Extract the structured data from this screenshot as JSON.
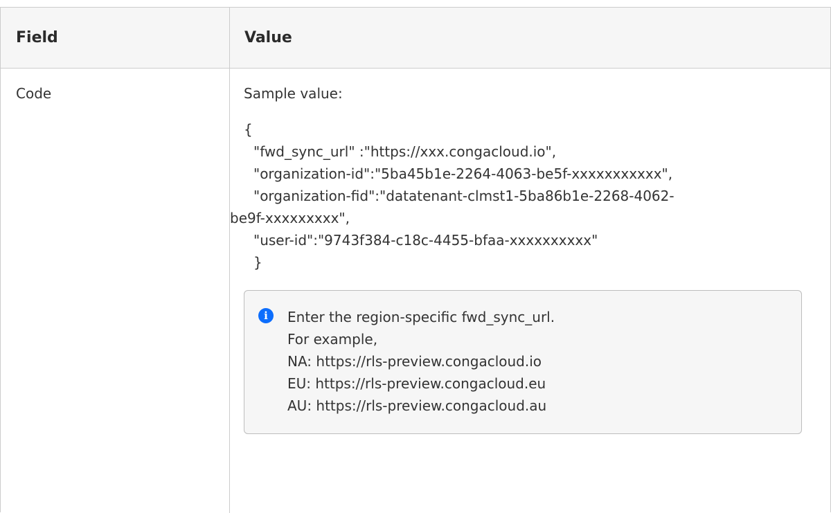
{
  "table": {
    "headers": {
      "field": "Field",
      "value": "Value"
    },
    "rows": [
      {
        "field": "Code",
        "sample_label": "Sample value:",
        "code": {
          "open": "{",
          "line1": "\"fwd_sync_url\" :\"https://xxx.congacloud.io\",",
          "line2": "\"organization-id\":\"5ba45b1e-2264-4063-be5f-xxxxxxxxxxx\",",
          "line3a": "\"organization-fid\":\"datatenant-clmst1-5ba86b1e-2268-4062-",
          "line3b": "be9f-xxxxxxxxx\",",
          "line4": "\"user-id\":\"9743f384-c18c-4455-bfaa-xxxxxxxxxx\"",
          "close": "}"
        },
        "note": {
          "icon": "info-icon",
          "icon_color": "#0d6efd",
          "lines": [
            "Enter the region-specific fwd_sync_url.",
            "For example,",
            "NA: https://rls-preview.congacloud.io",
            "EU: https://rls-preview.congacloud.eu",
            "AU: https://rls-preview.congacloud.au"
          ]
        }
      }
    ]
  }
}
